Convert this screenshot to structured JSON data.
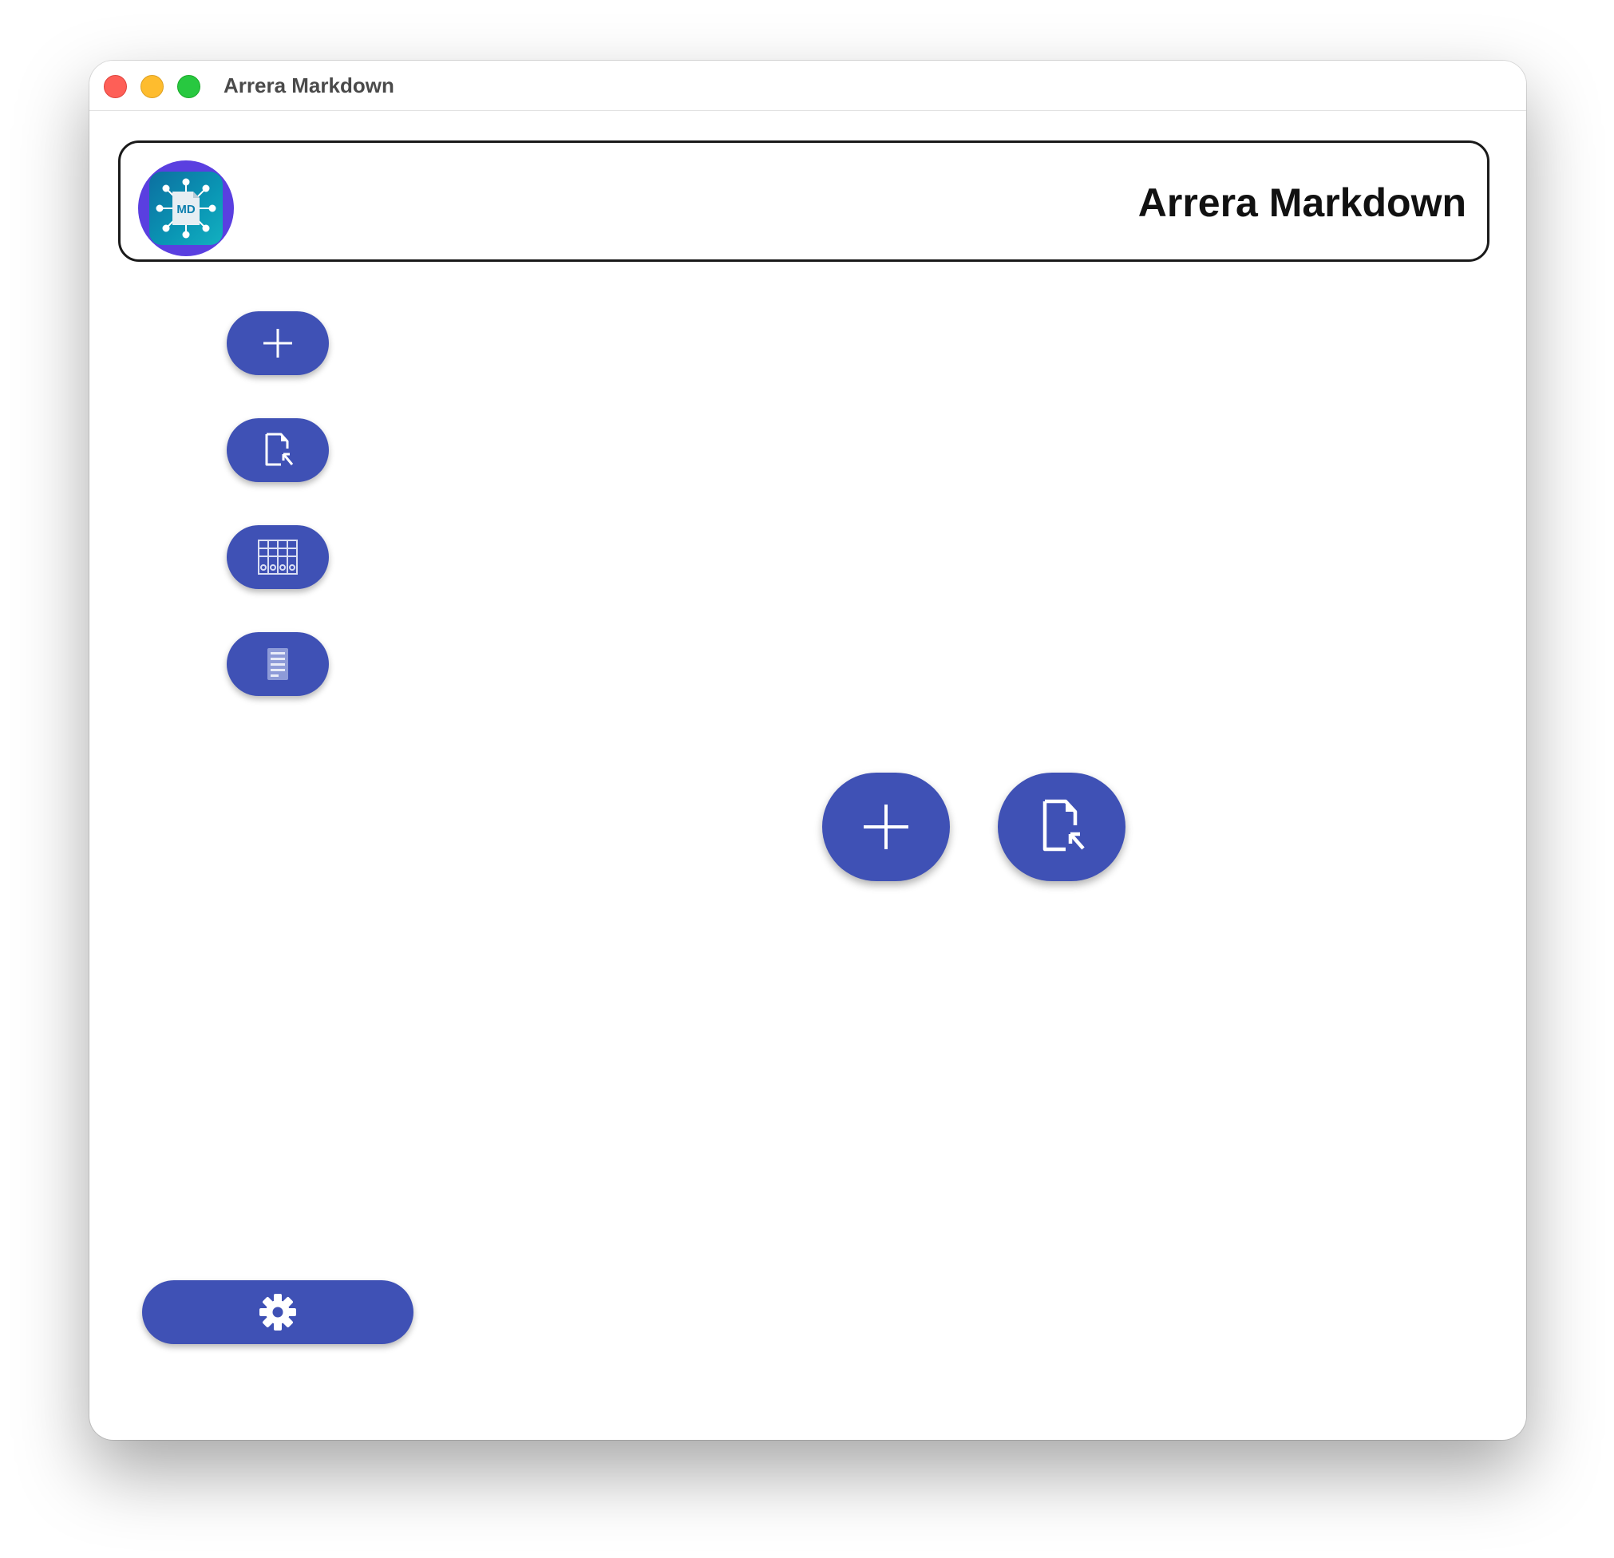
{
  "window": {
    "title": "Arrera Markdown"
  },
  "header": {
    "app_name": "Arrera Markdown",
    "logo_text": "MD"
  },
  "sidebar": {
    "items": [
      {
        "icon": "plus-icon"
      },
      {
        "icon": "open-file-icon"
      },
      {
        "icon": "library-icon"
      },
      {
        "icon": "document-list-icon"
      }
    ],
    "settings": {
      "icon": "gear-icon"
    }
  },
  "main": {
    "actions": [
      {
        "icon": "plus-icon"
      },
      {
        "icon": "open-file-icon"
      }
    ]
  },
  "colors": {
    "accent": "#3f51b5",
    "close": "#fe5f57",
    "minimize": "#febc2e",
    "maximize": "#28c840",
    "logo_ring": "#5a3fe0"
  }
}
